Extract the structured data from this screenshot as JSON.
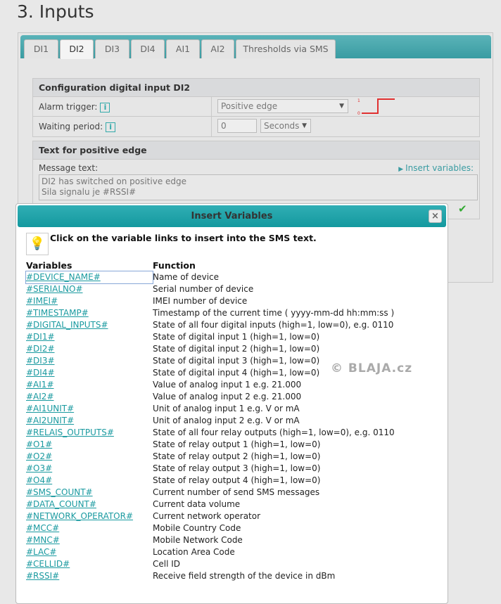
{
  "page_title": "3. Inputs",
  "tabs": [
    "DI1",
    "DI2",
    "DI3",
    "DI4",
    "AI1",
    "AI2",
    "Thresholds via SMS"
  ],
  "active_tab": "DI2",
  "config": {
    "header": "Configuration digital input DI2",
    "alarm_label": "Alarm trigger:",
    "alarm_value": "Positive edge",
    "waiting_label": "Waiting period:",
    "waiting_value": "0",
    "waiting_unit": "Seconds",
    "info_icon": "i",
    "edge_high": "1",
    "edge_low": "0"
  },
  "text_section": {
    "header": "Text for positive edge",
    "message_label": "Message text:",
    "insert_link": "Insert variables:",
    "message_line1": "DI2 has switched on positive edge",
    "message_line2": "Sila signalu je #RSSI#"
  },
  "dialog": {
    "title": "Insert Variables",
    "close": "×",
    "hint": "Click on the variable links to insert into the SMS text.",
    "col_variables": "Variables",
    "col_function": "Function",
    "rows": [
      {
        "var": "#DEVICE_NAME#",
        "fn": "Name of device"
      },
      {
        "var": "#SERIALNO#",
        "fn": "Serial number of device"
      },
      {
        "var": "#IMEI#",
        "fn": "IMEI number of device"
      },
      {
        "var": "#TIMESTAMP#",
        "fn": "Timestamp of the current time ( yyyy-mm-dd hh:mm:ss )"
      },
      {
        "var": "#DIGITAL_INPUTS#",
        "fn": "State of all four digital inputs (high=1, low=0), e.g. 0110"
      },
      {
        "var": "#DI1#",
        "fn": "State of digital input 1 (high=1, low=0)"
      },
      {
        "var": "#DI2#",
        "fn": "State of digital input 2 (high=1, low=0)"
      },
      {
        "var": "#DI3#",
        "fn": "State of digital input 3 (high=1, low=0)"
      },
      {
        "var": "#DI4#",
        "fn": "State of digital input 4 (high=1, low=0)"
      },
      {
        "var": "#AI1#",
        "fn": "Value of analog input 1 e.g. 21.000"
      },
      {
        "var": "#AI2#",
        "fn": "Value of analog input 2 e.g. 21.000"
      },
      {
        "var": "#AI1UNIT#",
        "fn": "Unit of analog input 1 e.g. V or mA"
      },
      {
        "var": "#AI2UNIT#",
        "fn": "Unit of analog input 2 e.g. V or mA"
      },
      {
        "var": "#RELAIS_OUTPUTS#",
        "fn": "State of all four relay outputs (high=1, low=0), e.g. 0110"
      },
      {
        "var": "#O1#",
        "fn": "State of relay output 1 (high=1, low=0)"
      },
      {
        "var": "#O2#",
        "fn": "State of relay output 2 (high=1, low=0)"
      },
      {
        "var": "#O3#",
        "fn": "State of relay output 3 (high=1, low=0)"
      },
      {
        "var": "#O4#",
        "fn": "State of relay output 4 (high=1, low=0)"
      },
      {
        "var": "#SMS_COUNT#",
        "fn": "Current number of send SMS messages"
      },
      {
        "var": "#DATA_COUNT#",
        "fn": "Current data volume"
      },
      {
        "var": "#NETWORK_OPERATOR#",
        "fn": "Current network operator"
      },
      {
        "var": "#MCC#",
        "fn": "Mobile Country Code"
      },
      {
        "var": "#MNC#",
        "fn": "Mobile Network Code"
      },
      {
        "var": "#LAC#",
        "fn": "Location Area Code"
      },
      {
        "var": "#CELLID#",
        "fn": "Cell ID"
      },
      {
        "var": "#RSSI#",
        "fn": "Receive field strength of the device in dBm"
      }
    ]
  },
  "watermark": "© BLAJA.cz",
  "colors": {
    "accent": "#1a9aa0",
    "edge_signal": "#e03030",
    "confirm": "#3a3"
  }
}
